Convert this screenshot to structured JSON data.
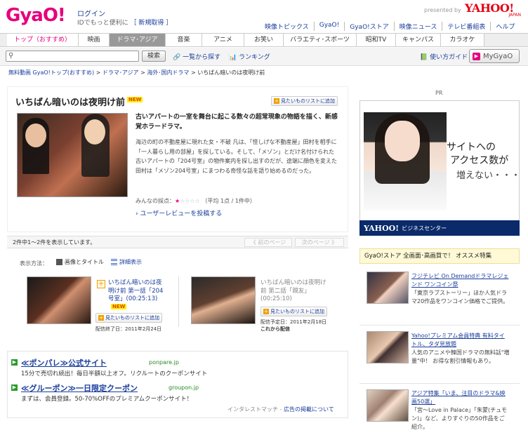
{
  "header": {
    "logo": "GyaO!",
    "login": "ログイン",
    "login_note": "IDでもっと便利に",
    "signup": "［ 新規取得 ］",
    "presented_by": "presented by",
    "sponsor": "YAHOO!",
    "sponsor_sub": "JAPAN",
    "links": [
      "映像トピックス",
      "GyaO!",
      "GyaO!ストア",
      "映像ニュース",
      "テレビ番組表",
      "ヘルプ"
    ]
  },
  "nav": {
    "tabs": [
      "トップ（おすすめ）",
      "映画",
      "ドラマ･アジア",
      "音楽",
      "アニメ",
      "お笑い",
      "バラエティ･スポーツ",
      "昭和TV",
      "キャンパス",
      "カラオケ"
    ],
    "active": "ドラマ･アジア"
  },
  "search": {
    "placeholder": "",
    "button": "検索",
    "list_link": "一覧から探す",
    "ranking_link": "ランキング",
    "guide_link": "使い方ガイド",
    "mygyao": "MyGyaO"
  },
  "breadcrumb": [
    "無料動画 GyaO!トップ(おすすめ)",
    "ドラマ･アジア",
    "海外･国内ドラマ",
    "いちばん暗いのは夜明け前"
  ],
  "program": {
    "title": "いちばん暗いのは夜明け前",
    "new_badge": "NEW",
    "add_to_list": "見たいものリストに追加",
    "lead": "古いアパートの一室を舞台に起こる数々の超常現象の物語を描く、新感覚ホラードラマ。",
    "description": "海辺の町の不動産屋に現れた女・不破 凡は、「怪しげな不動産屋」田村を相手に「一人暮らし用の部屋」を探している。そして、「メゾン」とだけ名付けられた古いアパートの「204号室」の物件案内を探し出すのだが、途端に顔色を変えた田村は「メゾン204号室」にまつわる奇怪な話を語り始めるのだった。",
    "rating_label": "みんなの採点：",
    "rating_stars_filled": "★",
    "rating_stars_empty": "☆☆☆☆",
    "rating_text": "（平均 1点 / 1件中）",
    "review_link": "ユーザーレビューを投稿する"
  },
  "listing": {
    "count_text": "2件中1～2件を表示しています。",
    "prev": "《 前のページ",
    "next": "次のページ 》",
    "view_label": "表示方法：",
    "view_grid": "画像とタイトル",
    "view_list": "詳細表示"
  },
  "episodes": [
    {
      "title": "いちばん暗いのは夜明け前 第一話「204号室」(00:25:13)",
      "new_badge": "NEW",
      "add_to_list": "見たいものリストに追加",
      "end_date": "配信終了日：2011年2月24日"
    },
    {
      "title": "いちばん暗いのは夜明け前 第二話「親友」(00:25:10)",
      "add_to_list": "見たいものリストに追加",
      "date": "配信予定日：2011年2月18日",
      "status": "これから配信"
    }
  ],
  "ads": [
    {
      "title": "≪ポンパレ≫公式サイト",
      "url": "ponpare.jp",
      "desc": "15分で売切れ続出！毎日半額以上オフ。リクルートのクーポンサイト"
    },
    {
      "title": "≪グルーポン≫一日限定クーポン",
      "url": "groupon.jp",
      "desc": "まずは、会員登録。50-70%OFFのプレミアムクーポンサイト！"
    }
  ],
  "ad_meta": {
    "label": "インタレストマッチ - ",
    "link": "広告の掲載について"
  },
  "right": {
    "pr": "PR",
    "banner_line1": "サイトへの",
    "banner_line2": "アクセス数が",
    "banner_line3": "増えない・・・",
    "banner_brand": "YAHOO!",
    "banner_brand_sub": "ビジネスセンター",
    "store_title": "GyaO!ストア 全画面･高画質で！ オススメ特集",
    "items": [
      {
        "title": "フジテレビ On Demandドラマレジェンド ワンコイン祭",
        "desc": "「東京ラブストーリー」ほか人気ドラマ20作品をワンコイン価格でご提供。"
      },
      {
        "title": "Yahoo!プレミアム会員特典 有料タイトル、タダ見放題",
        "desc": "人気のアニメや韓国ドラマの無料話\"増量\"中！ お得な割引情報もあり。"
      },
      {
        "title": "アジア特集「いま、注目のドラマ&映画50選」",
        "desc": "「宮～Love in Palace」「朱蒙(チュモン)」など、よりすぐりの50作品をご紹介。"
      }
    ]
  }
}
